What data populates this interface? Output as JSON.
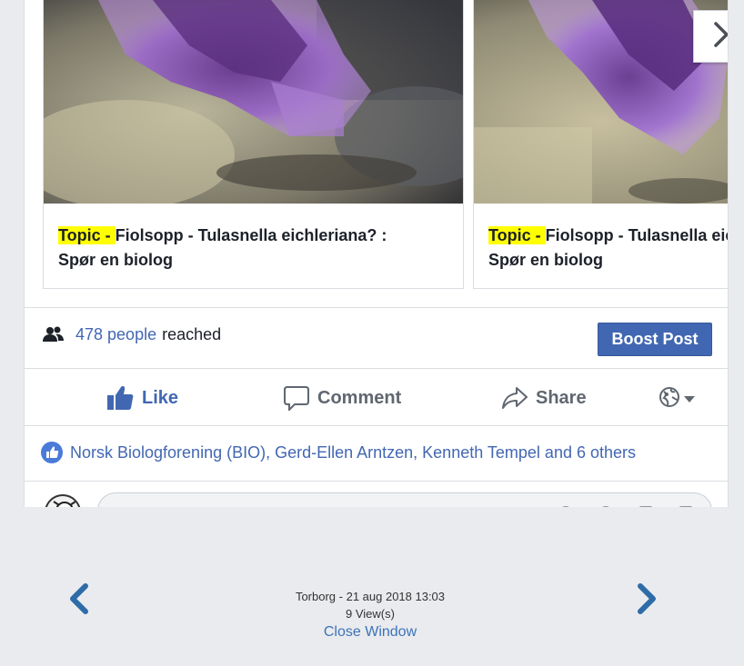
{
  "carousel": {
    "cards": [
      {
        "highlight": "Topic - ",
        "title_rest": "Fiolsopp - Tulasnella eichleriana? :",
        "subtitle": "Spør en biolog"
      },
      {
        "highlight": "Topic - ",
        "title_rest": "Fiolsopp - Tulasnella eichleriana? :",
        "subtitle": "Spør en biolog"
      }
    ],
    "next_icon": "chevron-right-icon"
  },
  "reach": {
    "count": "478 people",
    "label": "reached"
  },
  "boost_label": "Boost Post",
  "actions": {
    "like": "Like",
    "comment": "Comment",
    "share": "Share"
  },
  "reactions_text": "Norsk Biologforening (BIO), Gerd-Ellen Arntzen, Kenneth Tempel and 6 others",
  "footer": {
    "author_line": "Torborg - 21 aug 2018 13:03",
    "views": "9 View(s)",
    "close_label": "Close Window"
  },
  "colors": {
    "brand": "#4267b2",
    "highlight": "#ffff00",
    "nav_arrow": "#2e6ca8"
  }
}
